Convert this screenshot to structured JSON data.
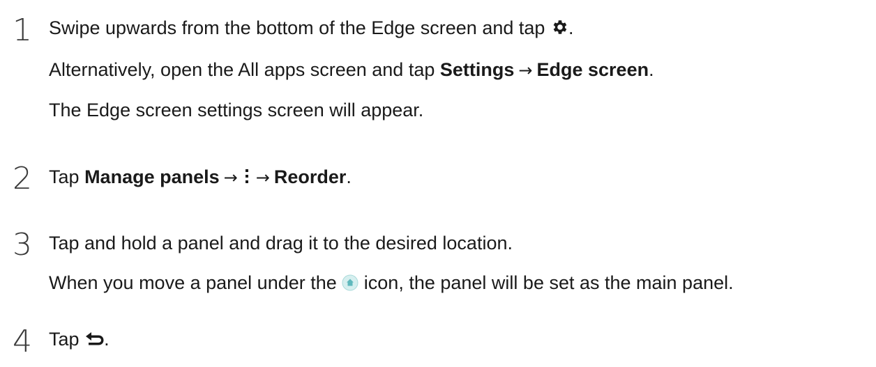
{
  "steps": [
    {
      "number": "1",
      "line1": "Swipe upwards from the bottom of the Edge screen and tap",
      "line1_end": ".",
      "line2_pre": "Alternatively, open the All apps screen and tap",
      "line2_b1": "Settings",
      "line2_arrow": "→",
      "line2_b2": "Edge screen",
      "line2_end": ".",
      "line3": "The Edge screen settings screen will appear.",
      "icon": "gear-icon"
    },
    {
      "number": "2",
      "pre": "Tap",
      "b1": "Manage panels",
      "arrow1": "→",
      "arrow2": "→",
      "b2": "Reorder",
      "end": ".",
      "icon": "more-options-icon"
    },
    {
      "number": "3",
      "line1": "Tap and hold a panel and drag it to the desired location.",
      "line2_pre": "When you move a panel under the",
      "line2_post": "icon, the panel will be set as the main panel.",
      "icon": "home-panel-icon"
    },
    {
      "number": "4",
      "pre": "Tap",
      "end": ".",
      "icon": "back-icon"
    }
  ],
  "colors": {
    "text": "#1a1a1a",
    "number": "#3a3a3a",
    "home_icon_fill": "#d6efef",
    "home_icon_accent": "#5fb8bc"
  }
}
